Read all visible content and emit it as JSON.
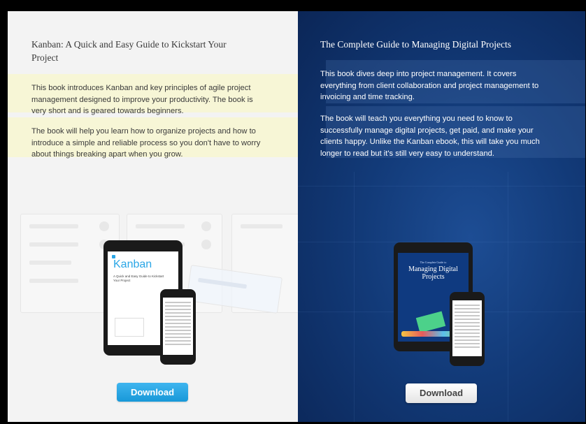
{
  "left_panel": {
    "title": "Kanban: A Quick and Easy Guide to Kickstart Your Project",
    "paragraph1": "This book introduces Kanban and key principles of agile project management designed to improve your productivity. The book is very short and is geared towards beginners.",
    "paragraph2": "The book will help you learn how to organize projects and how to introduce a simple and reliable process so you don't have to worry about things breaking apart when you grow.",
    "download_label": "Download",
    "cover": {
      "title": "Kanban",
      "subtitle": "A Quick and Easy Guide to Kickstart Your Project"
    },
    "button_color": "#1fa3e3"
  },
  "right_panel": {
    "title": "The Complete Guide to Managing Digital Projects",
    "paragraph1": "This book dives deep into project management. It covers everything from client collaboration and project management to invoicing and time tracking.",
    "paragraph2": "The book will teach you everything you need to know to successfully manage digital projects, get paid, and make your clients happy. Unlike the Kanban ebook, this will take you much longer to read but it's still very easy to understand.",
    "download_label": "Download",
    "cover": {
      "kicker": "The Complete Guide to",
      "title": "Managing Digital Projects"
    },
    "background_color": "#123a78"
  }
}
